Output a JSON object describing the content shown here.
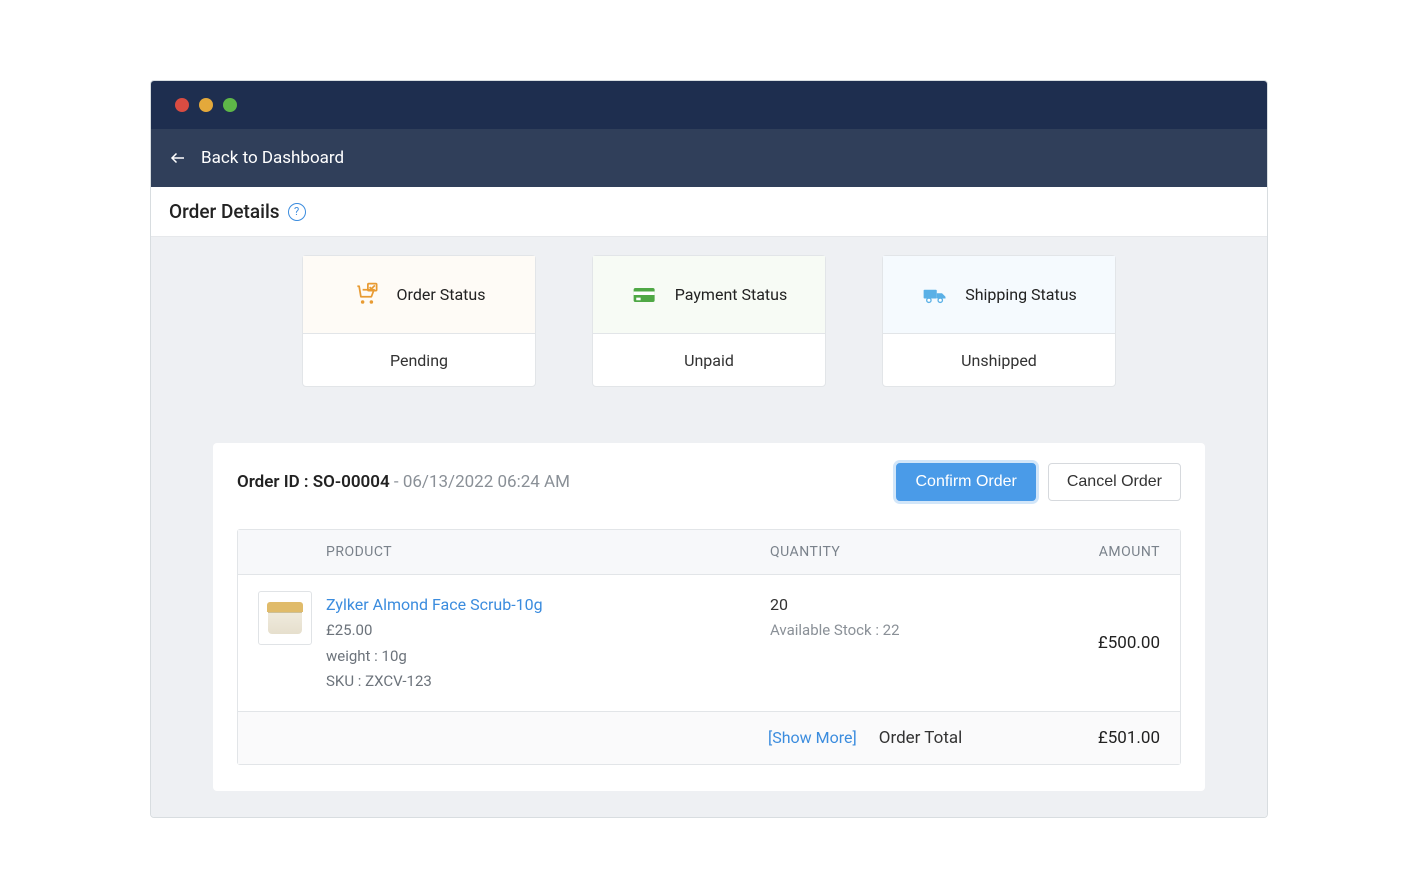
{
  "nav": {
    "back_label": "Back to Dashboard"
  },
  "subheader": {
    "title": "Order Details"
  },
  "status_cards": {
    "order": {
      "label": "Order Status",
      "value": "Pending"
    },
    "payment": {
      "label": "Payment Status",
      "value": "Unpaid"
    },
    "shipping": {
      "label": "Shipping Status",
      "value": "Unshipped"
    }
  },
  "panel": {
    "order_id_label": "Order ID : ",
    "order_id": "SO-00004",
    "order_separator": " - ",
    "order_timestamp": "06/13/2022 06:24 AM",
    "confirm_label": "Confirm Order",
    "cancel_label": "Cancel Order"
  },
  "table": {
    "head": {
      "product": "PRODUCT",
      "quantity": "QUANTITY",
      "amount": "AMOUNT"
    },
    "row": {
      "name": "Zylker Almond Face Scrub-10g",
      "price": "£25.00",
      "weight": "weight : 10g",
      "sku": "SKU : ZXCV-123",
      "qty": "20",
      "stock": "Available Stock : 22",
      "amount": "£500.00"
    },
    "foot": {
      "show_more": "[Show More]",
      "total_label": "Order Total",
      "total_value": "£501.00"
    }
  }
}
